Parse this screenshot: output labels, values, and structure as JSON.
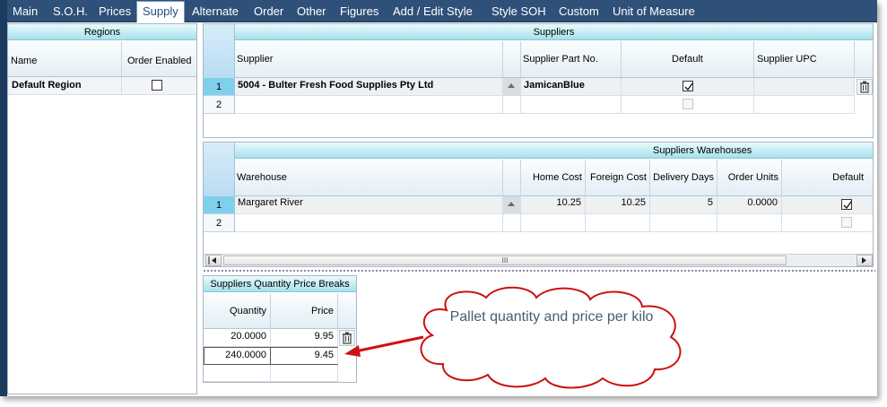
{
  "menu": [
    {
      "label": "Main",
      "active": false
    },
    {
      "label": "S.O.H.",
      "active": false
    },
    {
      "label": "Prices",
      "active": false
    },
    {
      "label": "Supply",
      "active": true
    },
    {
      "label": "Alternate",
      "active": false
    },
    {
      "label": "Order",
      "active": false
    },
    {
      "label": "Other",
      "active": false
    },
    {
      "label": "Figures",
      "active": false
    },
    {
      "label": "Add / Edit Style",
      "active": false
    },
    {
      "label": "Style SOH",
      "active": false
    },
    {
      "label": "Custom",
      "active": false
    },
    {
      "label": "Unit of Measure",
      "active": false
    }
  ],
  "regions": {
    "title": "Regions",
    "columns": [
      "Name",
      "Order Enabled"
    ],
    "rows": [
      {
        "name": "Default Region",
        "order_enabled": false
      }
    ]
  },
  "suppliers": {
    "title": "Suppliers",
    "columns": [
      "Supplier",
      "Supplier Part No.",
      "Default",
      "Supplier UPC"
    ],
    "rows": [
      {
        "num": "1",
        "supplier": "5004 - Bulter Fresh Food Supplies Pty Ltd",
        "part_no": "JamicanBlue",
        "default": true,
        "upc": ""
      },
      {
        "num": "2",
        "supplier": "",
        "part_no": "",
        "default": false,
        "upc": ""
      }
    ]
  },
  "warehouses": {
    "title": "Suppliers Warehouses",
    "columns": [
      "Warehouse",
      "Home Cost",
      "Foreign Cost",
      "Delivery Days",
      "Order Units",
      "Default"
    ],
    "rows": [
      {
        "num": "1",
        "warehouse": "Margaret River",
        "home_cost": "10.25",
        "foreign_cost": "10.25",
        "delivery_days": "5",
        "order_units": "0.0000",
        "default": true
      },
      {
        "num": "2",
        "warehouse": "",
        "home_cost": "",
        "foreign_cost": "",
        "delivery_days": "",
        "order_units": "",
        "default": false
      }
    ],
    "scroll_grip": "III"
  },
  "price_breaks": {
    "title": "Suppliers Quantity Price Breaks",
    "columns": [
      "Quantity",
      "Price"
    ],
    "rows": [
      {
        "quantity": "20.0000",
        "price": "9.95"
      },
      {
        "quantity": "240.0000",
        "price": "9.45"
      }
    ]
  },
  "callout": {
    "text": "Pallet quantity and price per kilo",
    "arrow_color": "#cc1111"
  },
  "colors": {
    "menubar": "#2f5078",
    "group_header": "#a6e1ec",
    "current_row": "#7fd0ec"
  }
}
